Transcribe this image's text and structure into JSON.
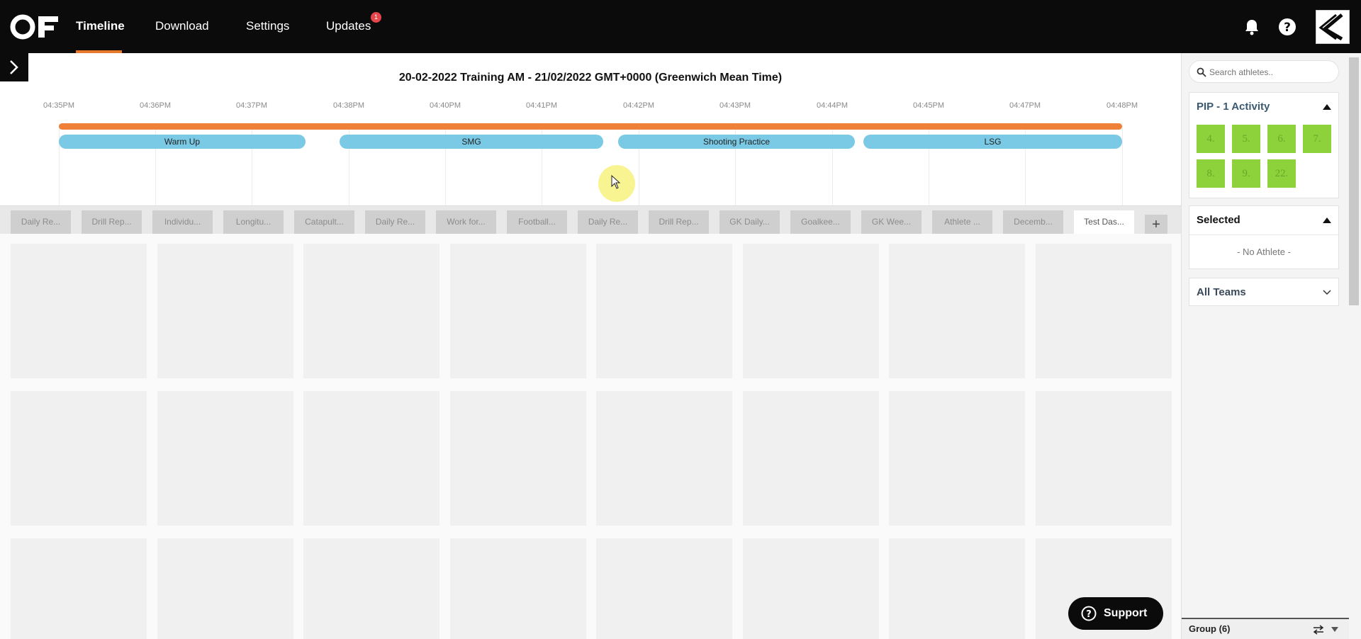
{
  "nav": {
    "items": [
      {
        "label": "Timeline",
        "active": true
      },
      {
        "label": "Download",
        "active": false
      },
      {
        "label": "Settings",
        "active": false
      },
      {
        "label": "Updates",
        "active": false
      }
    ],
    "updates_badge": "1",
    "icons": [
      "bell-icon",
      "help-icon",
      "brand-logo"
    ],
    "accent_color": "#e8792b",
    "badge_color": "#e5454b"
  },
  "timeline": {
    "title": "20-02-2022 Training AM - 21/02/2022 GMT+0000 (Greenwich Mean Time)",
    "ticks": [
      "04:35PM",
      "04:36PM",
      "04:37PM",
      "04:38PM",
      "04:40PM",
      "04:41PM",
      "04:42PM",
      "04:43PM",
      "04:44PM",
      "04:45PM",
      "04:47PM",
      "04:48PM"
    ],
    "bar_color": "#ef8037",
    "drills": [
      {
        "label": "Warm Up"
      },
      {
        "label": "SMG"
      },
      {
        "label": "Shooting Practice"
      },
      {
        "label": "LSG"
      }
    ],
    "drill_color": "#7acae5"
  },
  "tabs": [
    {
      "label": "Daily Re..."
    },
    {
      "label": "Drill Rep..."
    },
    {
      "label": "Individu..."
    },
    {
      "label": "Longitu..."
    },
    {
      "label": "Catapult..."
    },
    {
      "label": "Daily Re..."
    },
    {
      "label": "Work for..."
    },
    {
      "label": "Football..."
    },
    {
      "label": "Daily Re..."
    },
    {
      "label": "Drill Rep..."
    },
    {
      "label": "GK Daily..."
    },
    {
      "label": "Goalkee..."
    },
    {
      "label": "GK Wee..."
    },
    {
      "label": "Athlete ..."
    },
    {
      "label": "Decemb..."
    },
    {
      "label": "Test Das...",
      "active": true
    }
  ],
  "tab_add_label": "+",
  "support": {
    "label": "Support"
  },
  "sidebar": {
    "search_placeholder": "Search athletes..",
    "activity": {
      "title": "PIP - 1 Activity",
      "athletes": [
        "4.",
        "5.",
        "6.",
        "7.",
        "8.",
        "9.",
        "22."
      ],
      "chip_color": "#8dd13b",
      "title_color": "#3b5a72"
    },
    "selected": {
      "title": "Selected",
      "empty_text": "- No Athlete -"
    },
    "teams": {
      "title": "All Teams"
    },
    "group": {
      "label": "Group (6)"
    }
  }
}
